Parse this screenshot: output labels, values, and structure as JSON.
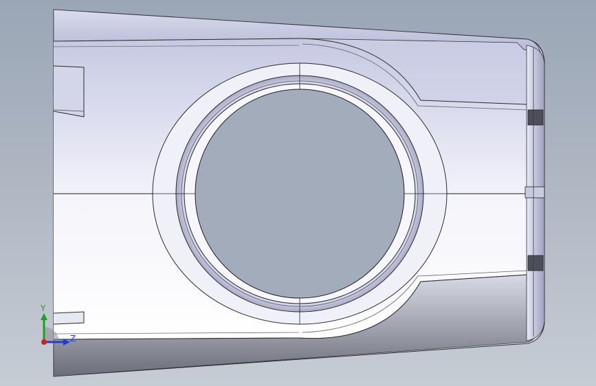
{
  "viewport": {
    "background_top": "#9aa6b6",
    "background_bottom": "#c6ccd4"
  },
  "model": {
    "icon": "cad-part-bracket-with-bore"
  },
  "triad": {
    "y_label": "Y",
    "z_label": "Z",
    "y_color": "#1f9d28",
    "z_color": "#1e3fd0",
    "x_color": "#d21f1f"
  }
}
